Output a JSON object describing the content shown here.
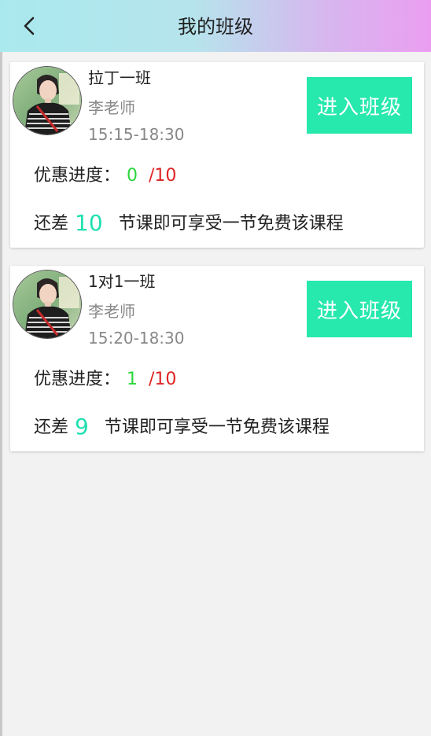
{
  "header": {
    "title": "我的班级",
    "back_icon": "chevron-left-icon",
    "gradient_colors": [
      "#a9e9ee",
      "#eb9ef1"
    ]
  },
  "classes": [
    {
      "name": "拉丁一班",
      "teacher": "李老师",
      "time": "15:15-18:30",
      "enter_label": "进入班级",
      "progress_label": "优惠进度：",
      "progress_done": "0",
      "progress_total": "/10",
      "remain_prefix": "还差",
      "remain_count": "10",
      "remain_suffix": "节课即可享受一节免费该课程",
      "avatar_icon": "teacher-avatar-photo"
    },
    {
      "name": "1对1一班",
      "teacher": "李老师",
      "time": "15:20-18:30",
      "enter_label": "进入班级",
      "progress_label": "优惠进度：",
      "progress_done": "1",
      "progress_total": "/10",
      "remain_prefix": "还差",
      "remain_count": "9",
      "remain_suffix": "节课即可享受一节免费该课程",
      "avatar_icon": "teacher-avatar-photo"
    }
  ],
  "colors": {
    "accent_button": "#27e8ad",
    "progress_done": "#2bd63a",
    "progress_total": "#e02323",
    "remain_count": "#1fe0b0"
  }
}
